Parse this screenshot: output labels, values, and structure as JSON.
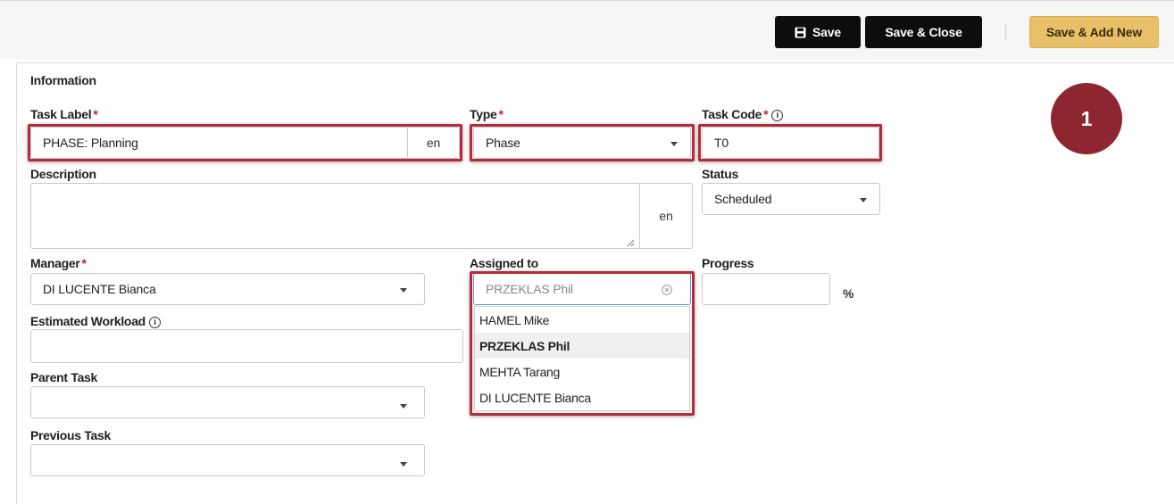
{
  "toolbar": {
    "save_label": "Save",
    "save_close_label": "Save & Close",
    "save_add_new_label": "Save & Add New",
    "save_icon": "floppy-disk-icon"
  },
  "form": {
    "section_title": "Information",
    "task_label": {
      "label": "Task Label",
      "required_mark": "*",
      "value": "PHASE: Planning",
      "lang": "en"
    },
    "type": {
      "label": "Type",
      "required_mark": "*",
      "value": "Phase"
    },
    "task_code": {
      "label": "Task Code",
      "required_mark": "*",
      "info": "i",
      "value": "T0"
    },
    "description": {
      "label": "Description",
      "value": "",
      "lang": "en"
    },
    "status": {
      "label": "Status",
      "value": "Scheduled"
    },
    "manager": {
      "label": "Manager",
      "required_mark": "*",
      "value": "DI LUCENTE Bianca"
    },
    "assigned_to": {
      "label": "Assigned to",
      "placeholder": "PRZEKLAS Phil",
      "options": [
        "HAMEL Mike",
        "PRZEKLAS Phil",
        "MEHTA Tarang",
        "DI LUCENTE Bianca"
      ],
      "highlighted": "PRZEKLAS Phil"
    },
    "progress": {
      "label": "Progress",
      "value": "",
      "unit": "%"
    },
    "estimated_workload": {
      "label": "Estimated Workload",
      "info": "i",
      "value": ""
    },
    "parent_task": {
      "label": "Parent Task",
      "value": ""
    },
    "previous_task": {
      "label": "Previous Task",
      "value": ""
    }
  },
  "annotation": {
    "step_number": "1",
    "highlight_color": "#b72a3a",
    "badge_color": "#8e2631"
  },
  "colors": {
    "primary_button": "#0d0d0d",
    "accent_button": "#e8c06a",
    "required": "#c0202e"
  }
}
